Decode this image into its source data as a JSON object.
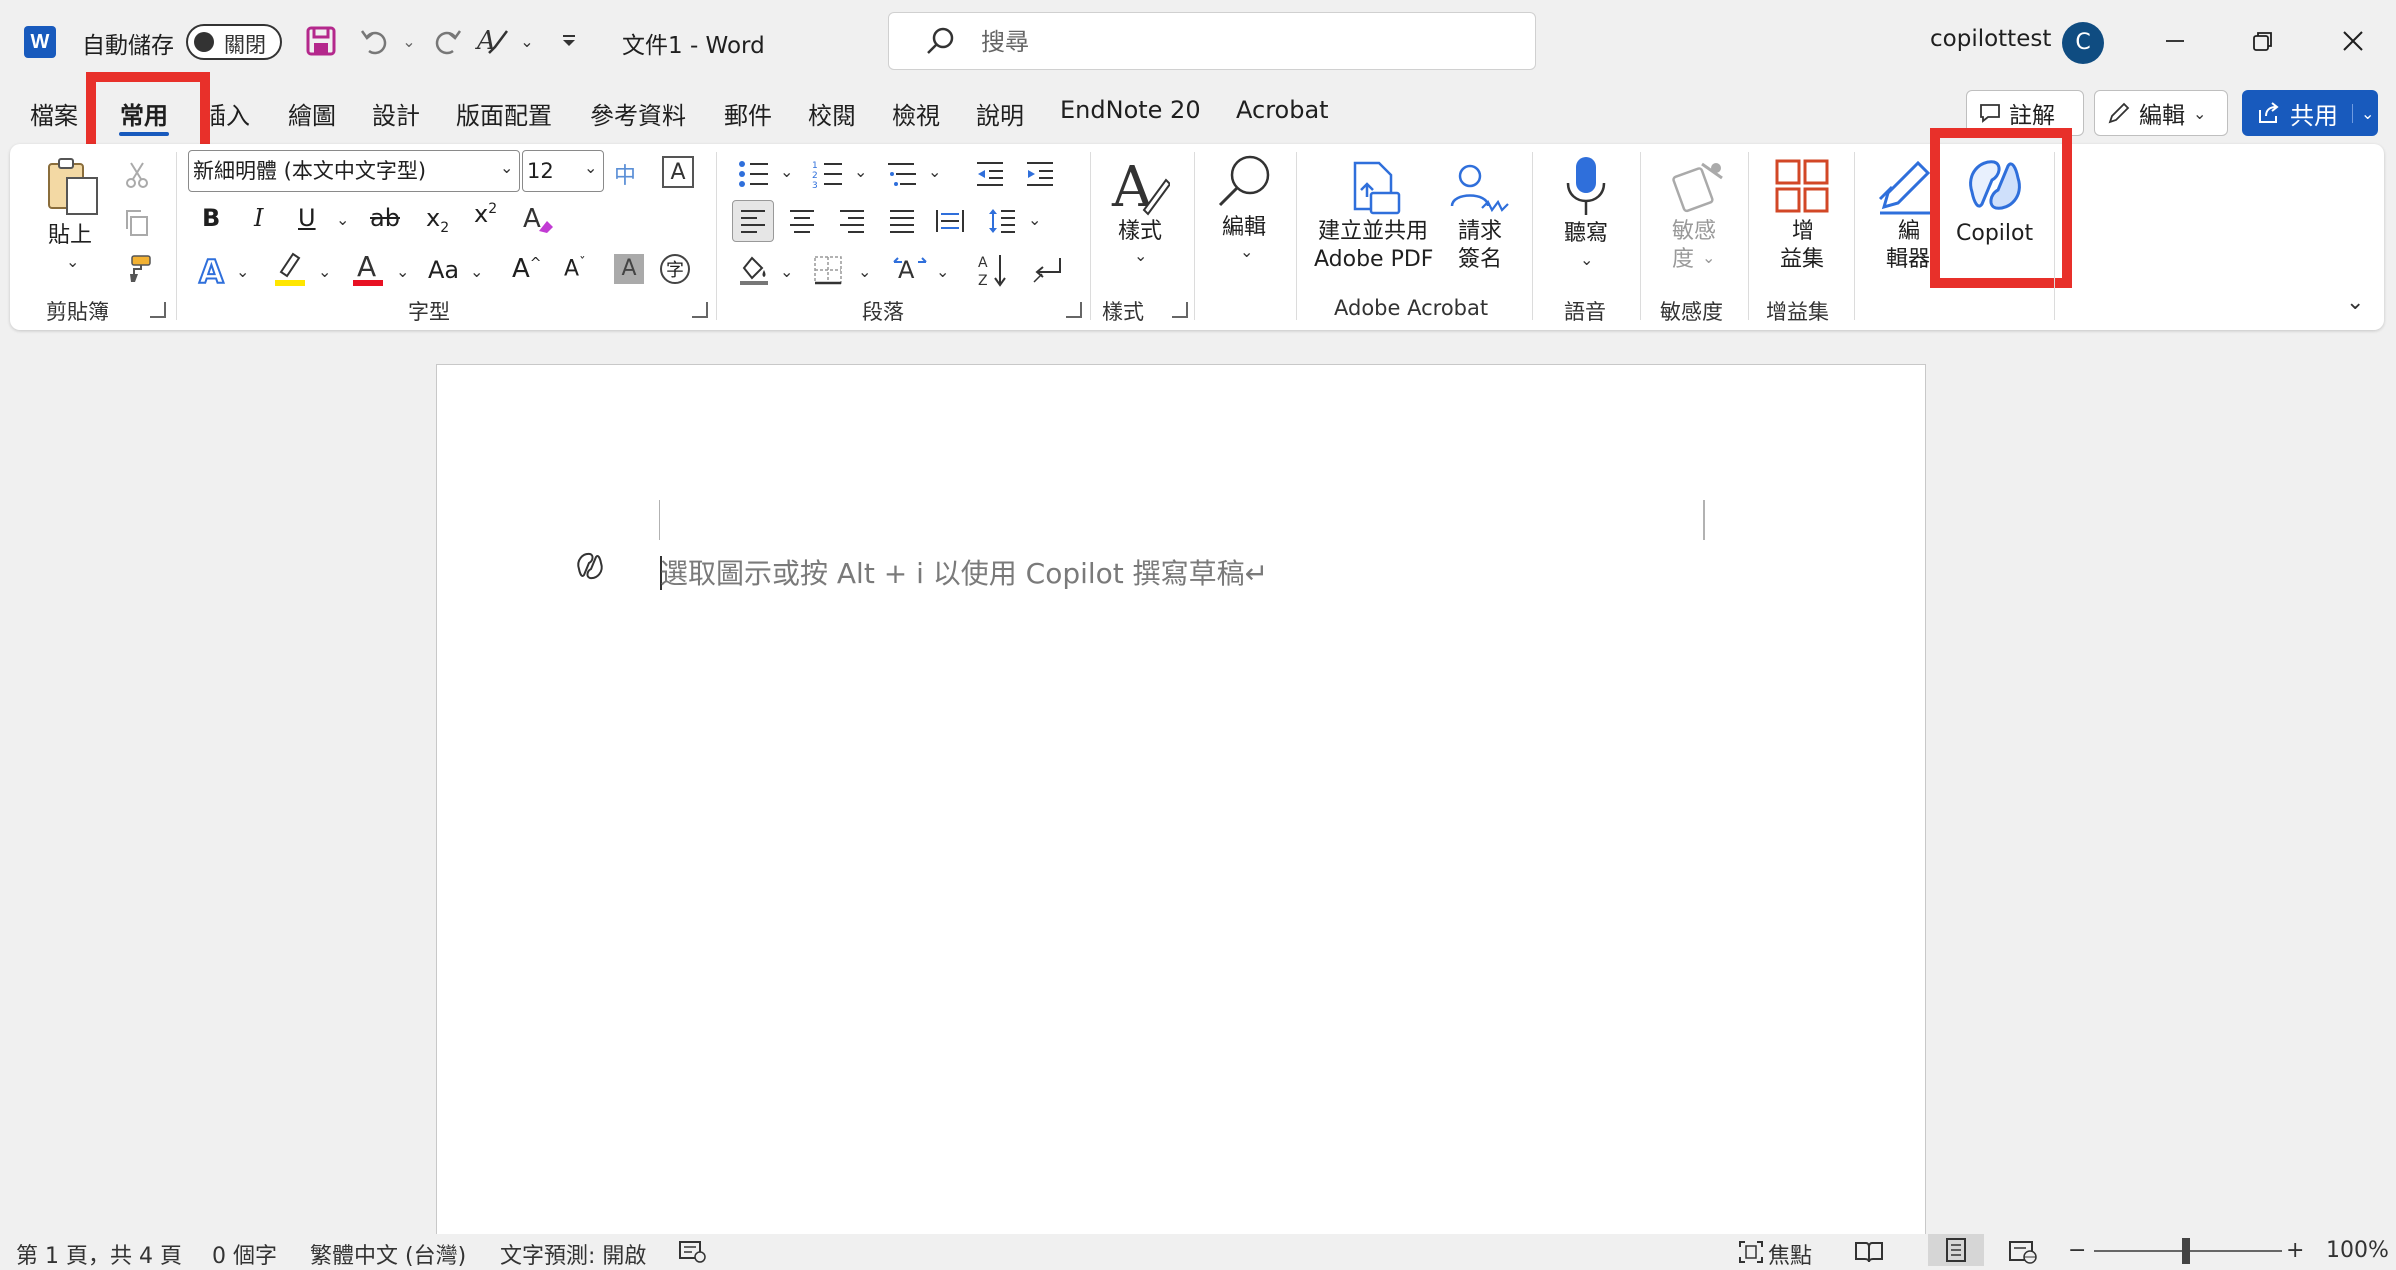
{
  "titlebar": {
    "autosave_label": "自動儲存",
    "autosave_state": "關閉",
    "doc_title": "文件1  -  Word",
    "search_placeholder": "搜尋",
    "user_name": "copilottest",
    "avatar_initial": "C"
  },
  "tabs": [
    "檔案",
    "常用",
    "插入",
    "繪圖",
    "設計",
    "版面配置",
    "參考資料",
    "郵件",
    "校閱",
    "檢視",
    "說明",
    "EndNote 20",
    "Acrobat"
  ],
  "active_tab": "常用",
  "header_buttons": {
    "comments": "註解",
    "editing": "編輯",
    "share": "共用"
  },
  "ribbon": {
    "clipboard": {
      "paste": "貼上",
      "group": "剪貼簿"
    },
    "font": {
      "font_name": "新細明體 (本文中文字型)",
      "font_size": "12",
      "group": "字型",
      "bold": "B",
      "italic": "I",
      "underline": "U",
      "strike": "ab",
      "subscript": "x",
      "superscript": "x",
      "change_case": "Aa",
      "grow": "A",
      "shrink": "A",
      "phonetic": "中",
      "char_border": "A",
      "char_shade": "A",
      "enclose": "字"
    },
    "paragraph": {
      "group": "段落"
    },
    "styles": {
      "label": "樣式",
      "group": "樣式"
    },
    "editing": {
      "label": "編輯"
    },
    "acrobat": {
      "create_pdf_1": "建立並共用",
      "create_pdf_2": "Adobe PDF",
      "sign_1": "請求",
      "sign_2": "簽名",
      "group": "Adobe Acrobat"
    },
    "voice": {
      "dictate": "聽寫",
      "group": "語音"
    },
    "sensitivity": {
      "label_1": "敏感",
      "label_2": "度",
      "group": "敏感度"
    },
    "addins": {
      "label_1": "增",
      "label_2": "益集",
      "group": "增益集"
    },
    "editor": {
      "label_1": "編",
      "label_2": "輯器"
    },
    "copilot": {
      "label": "Copilot"
    }
  },
  "document": {
    "placeholder": "選取圖示或按 Alt + i 以使用 Copilot 撰寫草稿↵"
  },
  "statusbar": {
    "page": "第 1 頁，共 4 頁",
    "words": "0 個字",
    "language": "繁體中文 (台灣)",
    "prediction": "文字預測: 開啟",
    "focus": "焦點",
    "zoom": "100%",
    "zoom_minus": "−",
    "zoom_plus": "+"
  },
  "colors": {
    "accent": "#185abd",
    "highlight_box": "#e8302a",
    "copilot_blue": "#2f6fdb"
  }
}
